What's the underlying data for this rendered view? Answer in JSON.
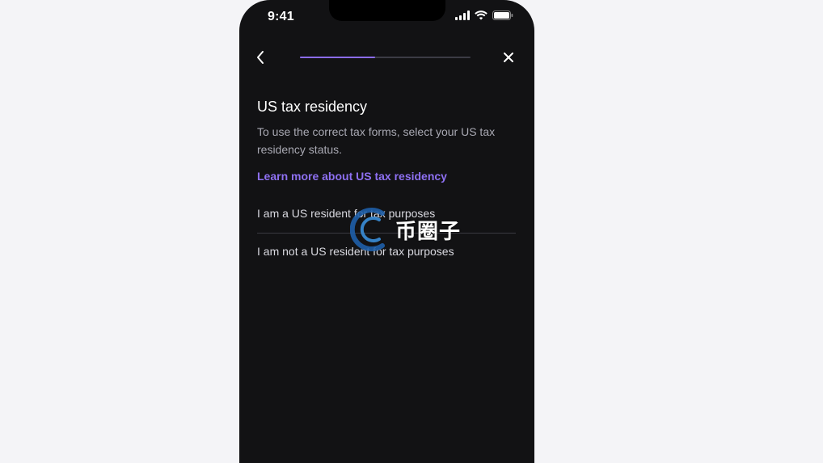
{
  "status_bar": {
    "time": "9:41",
    "icons": [
      "signal-icon",
      "wifi-icon",
      "battery-icon"
    ]
  },
  "nav": {
    "back_icon": "chevron-left-icon",
    "close_icon": "close-icon",
    "progress": 0.44
  },
  "content": {
    "title": "US tax residency",
    "subtitle": "To use the correct tax forms, select your US tax residency status.",
    "learn_more_label": "Learn more about US tax residency",
    "options": [
      {
        "label": "I am a US resident for tax purposes"
      },
      {
        "label": "I am not a US resident for tax purposes"
      }
    ]
  },
  "watermark": {
    "text": "币圈子"
  },
  "colors": {
    "background": "#f4f4f7",
    "phone_bg": "#121214",
    "accent": "#8e70f2",
    "text_primary": "#ffffff",
    "text_secondary": "#a9a9b3"
  }
}
